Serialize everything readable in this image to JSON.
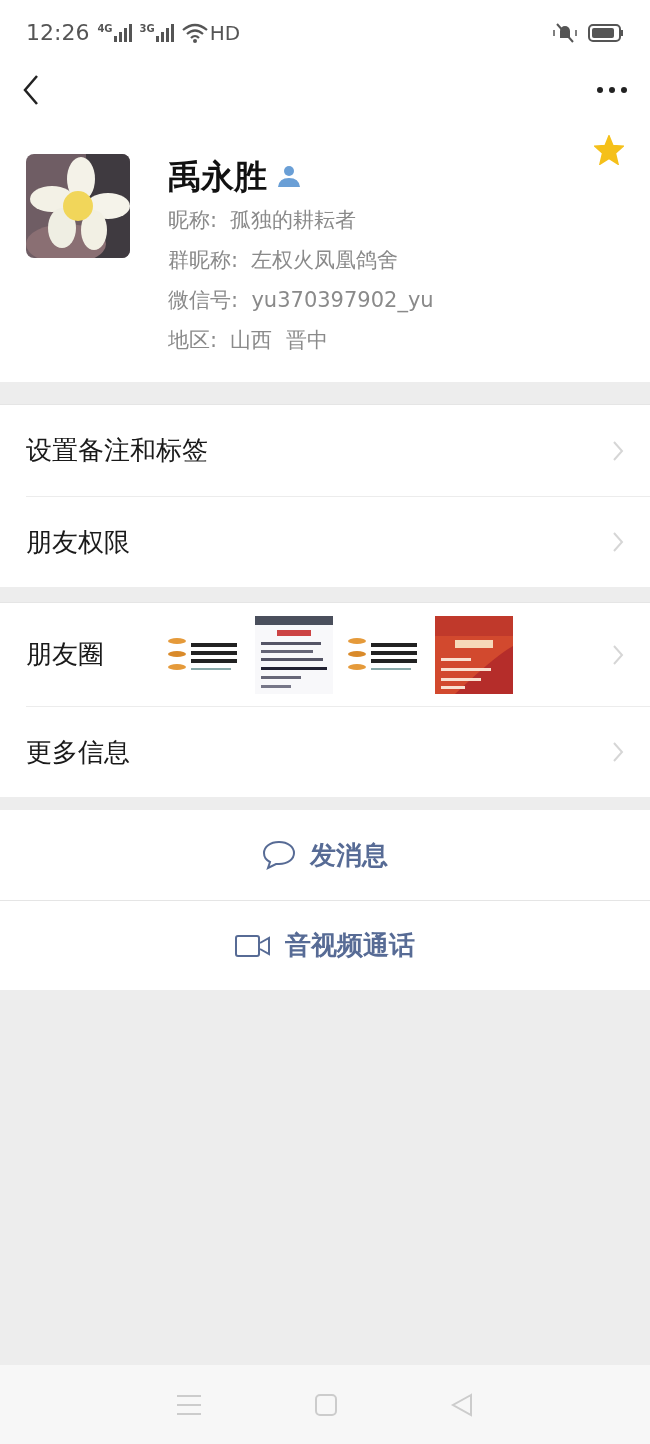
{
  "status_bar": {
    "time": "12:26",
    "networks": [
      "4G",
      "3G"
    ],
    "wifi_label": "HD"
  },
  "profile": {
    "name": "禹永胜",
    "starred": true,
    "details": [
      "昵称:  孤独的耕耘者",
      "群昵称:  左权火凤凰鸽舍",
      "微信号:  yu370397902_yu",
      "地区:  山西  晋中"
    ]
  },
  "menu_groups": [
    [
      {
        "label": "设置备注和标签",
        "kind": "plain"
      },
      {
        "label": "朋友权限",
        "kind": "plain"
      }
    ],
    [
      {
        "label": "朋友圈",
        "kind": "moments"
      },
      {
        "label": "更多信息",
        "kind": "plain"
      }
    ]
  ],
  "actions": [
    {
      "label": "发消息",
      "kind": "message"
    },
    {
      "label": "音视频通话",
      "kind": "call"
    }
  ]
}
